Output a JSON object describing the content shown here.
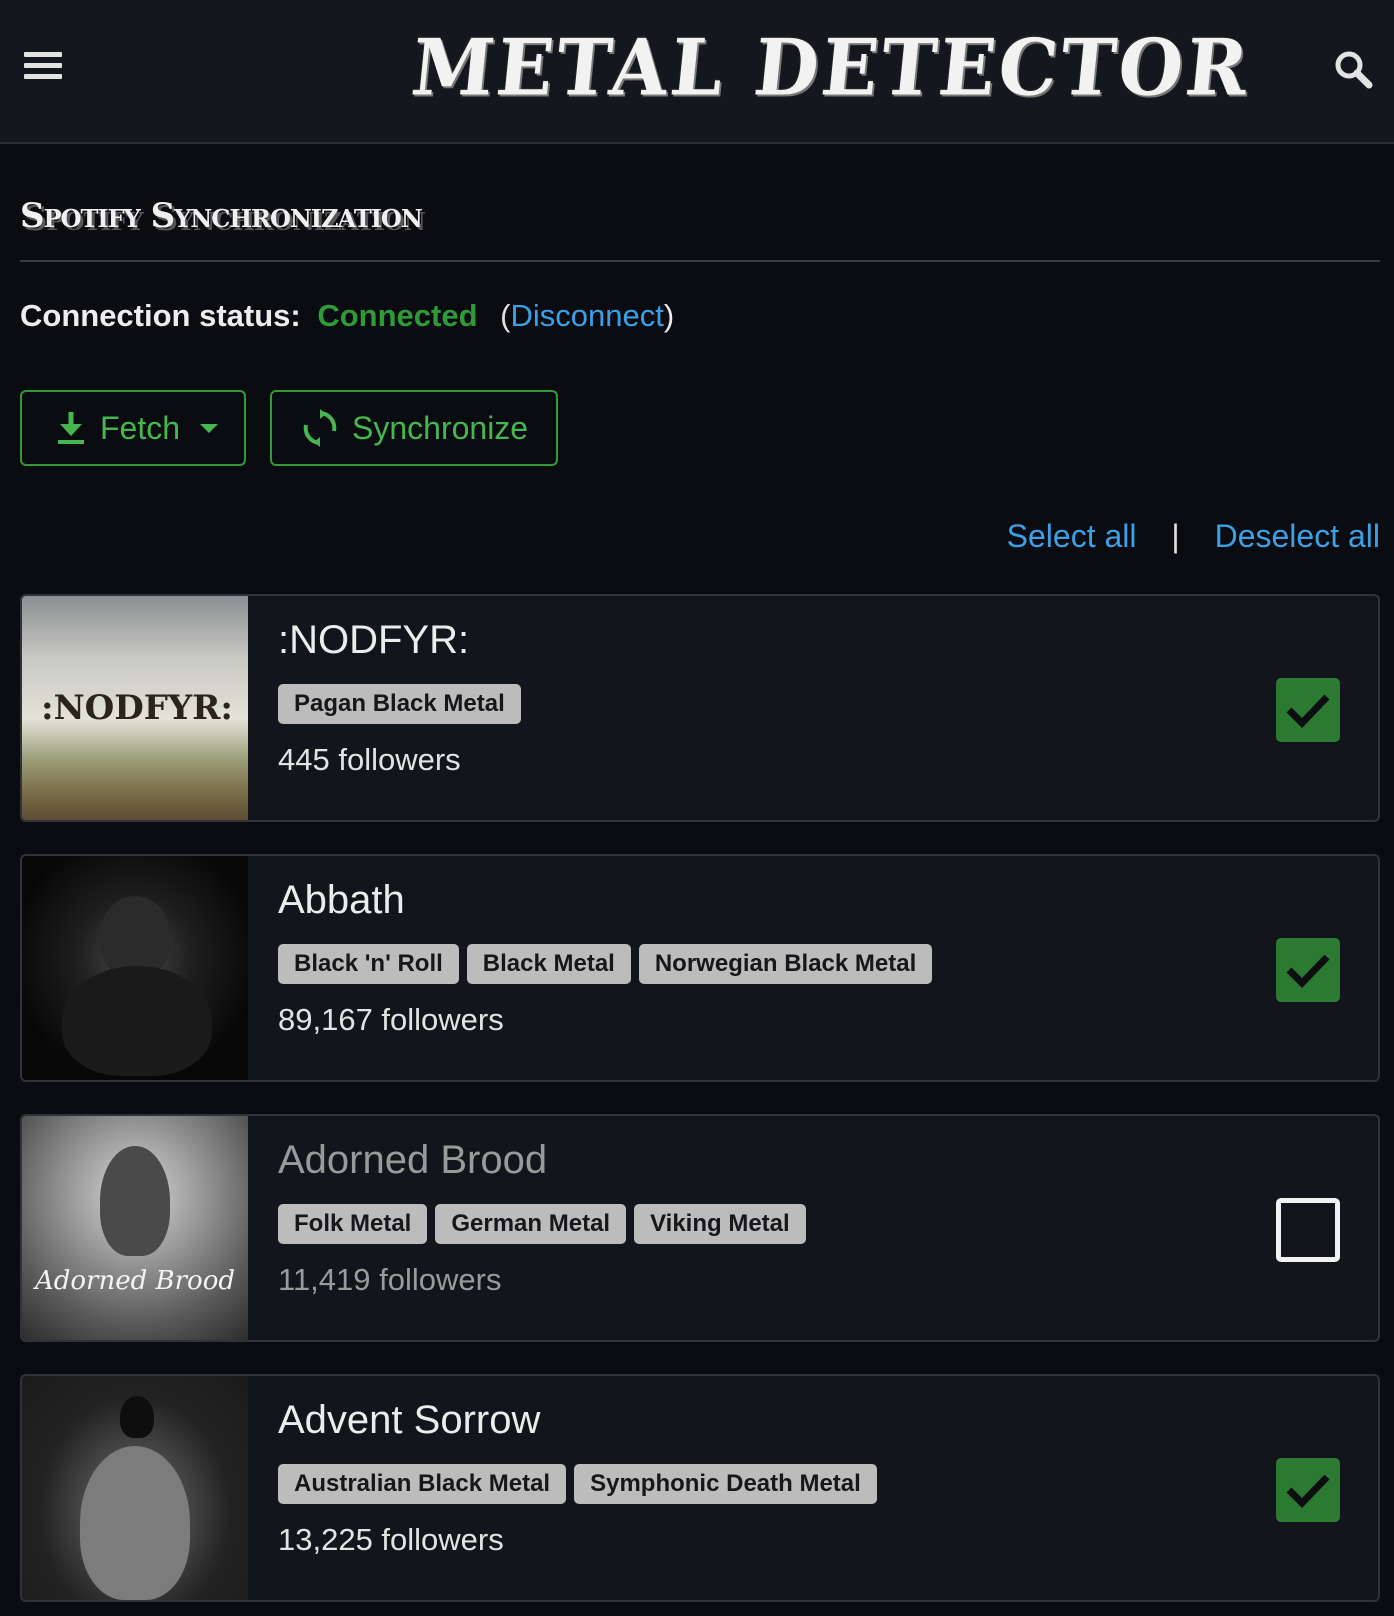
{
  "header": {
    "menu_icon": "hamburger-icon",
    "logo_text": "METAL DETECTOR",
    "search_icon": "search-icon"
  },
  "page": {
    "title": "Spotify Synchronization",
    "connection_label": "Connection status:",
    "connection_value": "Connected",
    "disconnect_open": "(",
    "disconnect_link": "Disconnect",
    "disconnect_close": ")"
  },
  "actions": {
    "fetch_label": "Fetch",
    "fetch_icon": "download-icon",
    "sync_label": "Synchronize",
    "sync_icon": "sync-icon",
    "select_all": "Select all",
    "separator": "|",
    "deselect_all": "Deselect all"
  },
  "colors": {
    "accent_green": "#2f9a37",
    "link_blue": "#3ba0e6",
    "checkbox_checked": "#2c7a31"
  },
  "artists": [
    {
      "name": ":NODFYR:",
      "genres": [
        "Pagan Black Metal"
      ],
      "followers": "445 followers",
      "selected": true,
      "thumb_text": ":NODFYR:"
    },
    {
      "name": "Abbath",
      "genres": [
        "Black 'n' Roll",
        "Black Metal",
        "Norwegian Black Metal"
      ],
      "followers": "89,167 followers",
      "selected": true,
      "thumb_text": ""
    },
    {
      "name": "Adorned Brood",
      "genres": [
        "Folk Metal",
        "German Metal",
        "Viking Metal"
      ],
      "followers": "11,419 followers",
      "selected": false,
      "thumb_text": "Adorned Brood"
    },
    {
      "name": "Advent Sorrow",
      "genres": [
        "Australian Black Metal",
        "Symphonic Death Metal"
      ],
      "followers": "13,225 followers",
      "selected": true,
      "thumb_text": ""
    }
  ]
}
